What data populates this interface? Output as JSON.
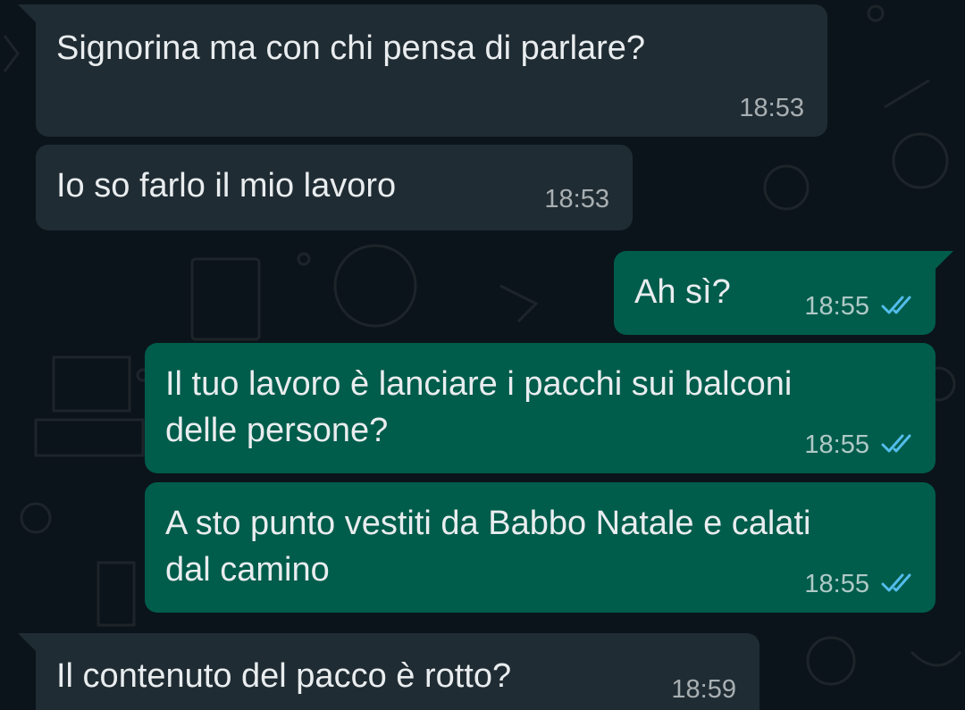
{
  "messages": [
    {
      "direction": "in",
      "text": "Signorina ma con chi pensa di parlare?",
      "time": "18:53"
    },
    {
      "direction": "in",
      "text": "Io so farlo il mio lavoro",
      "time": "18:53"
    },
    {
      "direction": "out",
      "text": "Ah sì?",
      "time": "18:55",
      "status": "read"
    },
    {
      "direction": "out",
      "text": "Il tuo lavoro è lanciare i pacchi sui balconi\ndelle persone?",
      "time": "18:55",
      "status": "read"
    },
    {
      "direction": "out",
      "text": "A sto punto vestiti da Babbo Natale e calati\ndal camino",
      "time": "18:55",
      "status": "read"
    },
    {
      "direction": "in",
      "text": "Il contenuto del pacco è rotto?",
      "time": "18:59"
    }
  ],
  "colors": {
    "background": "#0b141a",
    "incoming_bubble": "#202c33",
    "outgoing_bubble": "#005c4b",
    "read_ticks": "#53bdeb"
  }
}
